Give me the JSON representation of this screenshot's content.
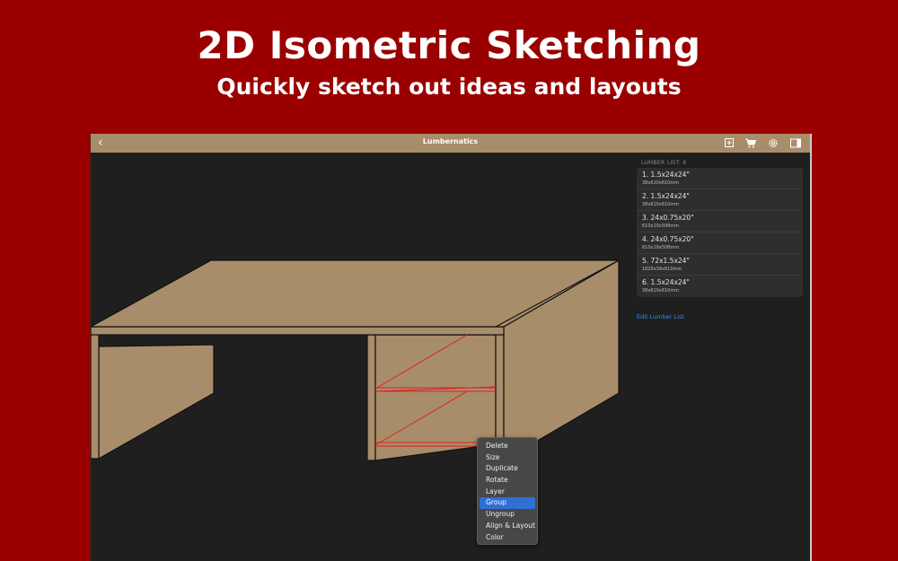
{
  "hero": {
    "title": "2D Isometric Sketching",
    "subtitle": "Quickly sketch out ideas and layouts"
  },
  "toolbar": {
    "title": "Lumbernatics",
    "back_icon": "chevron-left-icon",
    "icons": [
      "add-square-icon",
      "cart-icon",
      "gear-icon",
      "sidebar-icon"
    ]
  },
  "panel": {
    "header_label": "LUMBER LIST: ",
    "header_count": "6",
    "items": [
      {
        "name": "1. 1.5x24x24\"",
        "metric": "38x610x610mm"
      },
      {
        "name": "2. 1.5x24x24\"",
        "metric": "38x610x610mm"
      },
      {
        "name": "3. 24x0.75x20\"",
        "metric": "610x19x508mm"
      },
      {
        "name": "4. 24x0.75x20\"",
        "metric": "610x19x508mm"
      },
      {
        "name": "5. 72x1.5x24\"",
        "metric": "1829x38x610mm"
      },
      {
        "name": "6. 1.5x24x24\"",
        "metric": "38x610x610mm"
      }
    ],
    "edit_link": "Edit Lumber List"
  },
  "context_menu": {
    "items": [
      "Delete",
      "Size",
      "Duplicate",
      "Rotate",
      "Layer",
      "Group",
      "Ungroup",
      "Align & Layout",
      "Color"
    ],
    "selected": "Group"
  },
  "colors": {
    "background": "#9a0000",
    "wood": "#a88d6a",
    "canvas": "#1f1f1f",
    "selection": "#e02020",
    "menu_highlight": "#2f6fd6",
    "link": "#3a8ee8"
  }
}
